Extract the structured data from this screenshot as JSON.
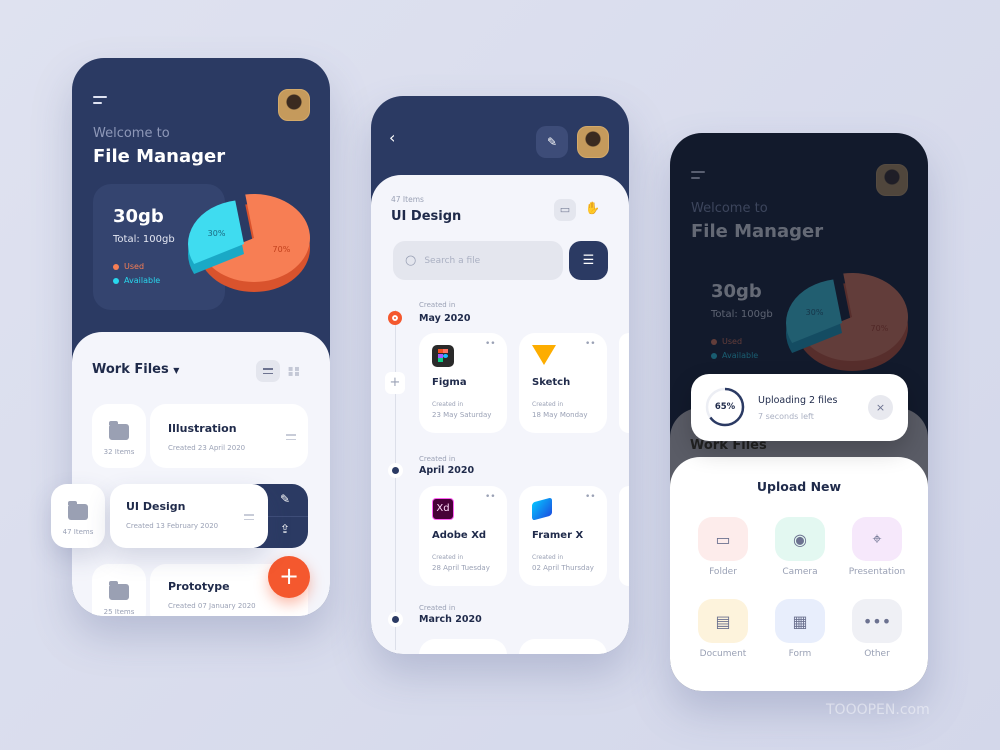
{
  "colors": {
    "navy": "#2b3a63",
    "accent": "#f4582e",
    "used": "#f77e54",
    "available": "#28d8ee"
  },
  "home": {
    "welcome": "Welcome to",
    "title": "File Manager",
    "storage": {
      "used_value": "30gb",
      "total": "Total: 100gb",
      "legend": [
        {
          "label": "Used",
          "color": "#f77e54"
        },
        {
          "label": "Available",
          "color": "#28d8ee"
        }
      ]
    },
    "chart_data": {
      "type": "pie",
      "categories": [
        "Used",
        "Available"
      ],
      "values": [
        70,
        30
      ],
      "labels": [
        "70%",
        "30%"
      ]
    },
    "section_title": "Work Files",
    "files": [
      {
        "name": "Illustration",
        "items": "32 Items",
        "created": "Created 23 April 2020"
      },
      {
        "name": "UI Design",
        "items": "47 Items",
        "created": "Created 13 February 2020"
      },
      {
        "name": "Prototype",
        "items": "25 Items",
        "created": "Created 07 January 2020"
      }
    ],
    "fab": "+"
  },
  "folder": {
    "count": "47 Items",
    "title": "UI Design",
    "search_placeholder": "Search a file",
    "groups": [
      {
        "caption": "Created in",
        "month": "May 2020",
        "files": [
          {
            "name": "Figma",
            "caption": "Created in",
            "date": "23 May Saturday",
            "icon": "figma-icon"
          },
          {
            "name": "Sketch",
            "caption": "Created in",
            "date": "18 May Monday",
            "icon": "sketch-icon"
          }
        ]
      },
      {
        "caption": "Created in",
        "month": "April 2020",
        "files": [
          {
            "name": "Adobe Xd",
            "caption": "Created in",
            "date": "28 April Tuesday",
            "icon": "xd-icon",
            "glyph": "Xd"
          },
          {
            "name": "Framer X",
            "caption": "Created in",
            "date": "02 April Thursday",
            "icon": "framer-icon"
          }
        ]
      },
      {
        "caption": "Created in",
        "month": "March 2020",
        "files": []
      }
    ]
  },
  "upload": {
    "progress": {
      "percent_label": "65%",
      "percent": 65,
      "title": "Uploading 2 files",
      "eta": "7 seconds left"
    },
    "sheet_title": "Upload New",
    "options": [
      {
        "label": "Folder",
        "icon": "folder-icon",
        "bg": "#fdeceb"
      },
      {
        "label": "Camera",
        "icon": "camera-icon",
        "bg": "#e3f8f1"
      },
      {
        "label": "Presentation",
        "icon": "presentation-icon",
        "bg": "#f6e8fb"
      },
      {
        "label": "Document",
        "icon": "document-icon",
        "bg": "#fdf3dc"
      },
      {
        "label": "Form",
        "icon": "form-icon",
        "bg": "#e8eefc"
      },
      {
        "label": "Other",
        "icon": "more-icon",
        "bg": "#eff0f5"
      }
    ],
    "behind": {
      "section_title": "Work Files"
    }
  },
  "watermark": "TOOOPEN.com"
}
